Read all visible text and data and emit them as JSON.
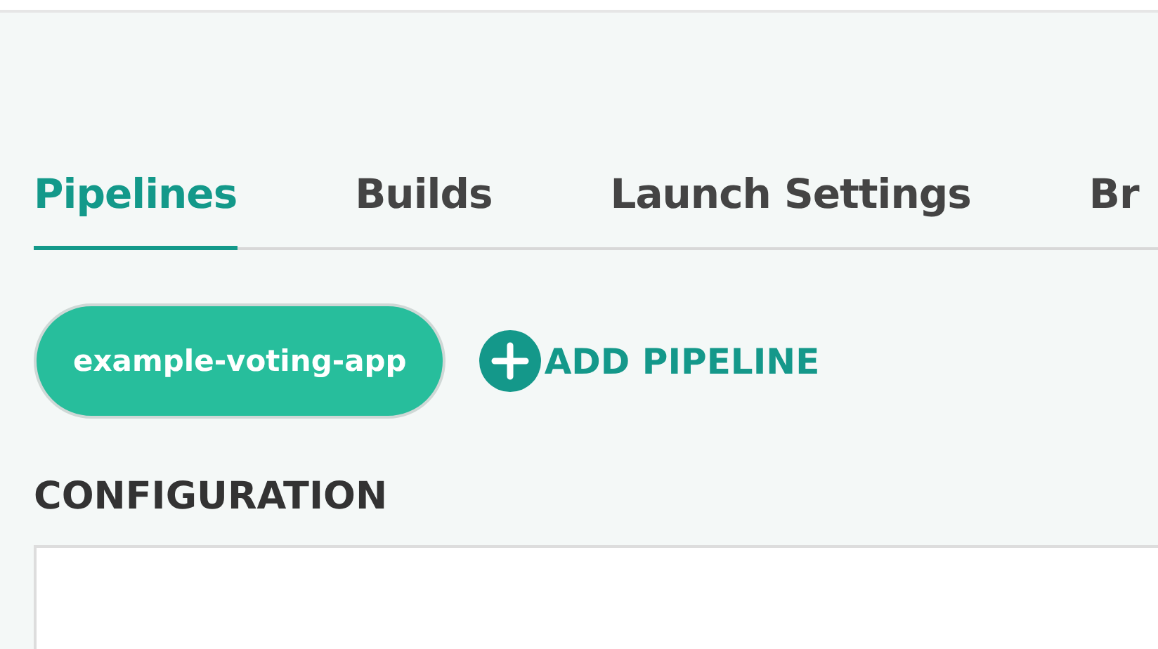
{
  "tabs": [
    {
      "label": "Pipelines",
      "selected": true
    },
    {
      "label": "Builds",
      "selected": false
    },
    {
      "label": "Launch Settings",
      "selected": false
    },
    {
      "label": "Br",
      "selected": false
    }
  ],
  "pipelines": [
    {
      "label": "example-voting-app",
      "selected": true
    }
  ],
  "add_pipeline": {
    "label": "ADD PIPELINE"
  },
  "configuration": {
    "heading": "CONFIGURATION"
  }
}
